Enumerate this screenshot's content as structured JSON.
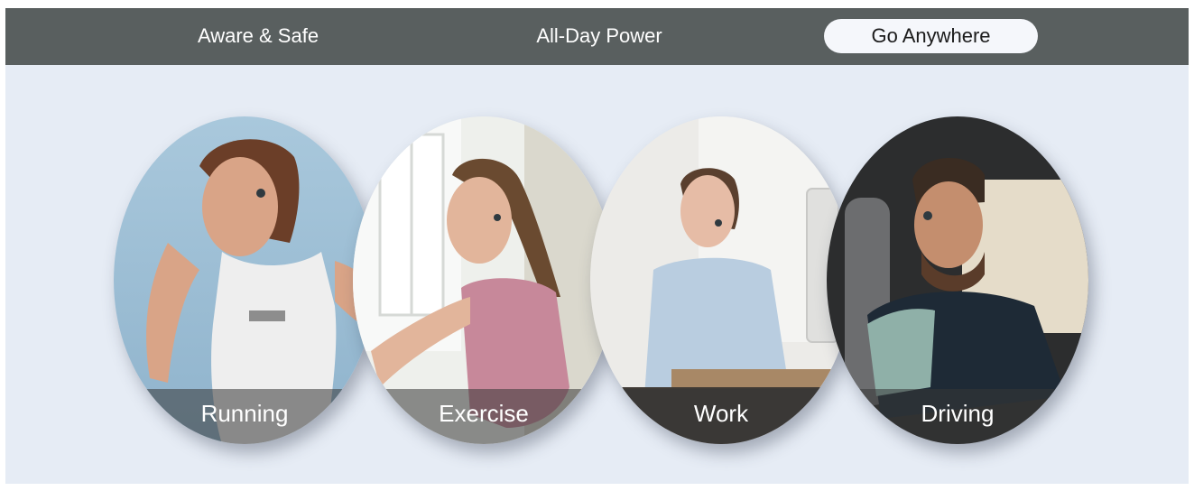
{
  "tabs": [
    {
      "label": "Aware & Safe",
      "active": false
    },
    {
      "label": "All-Day Power",
      "active": false
    },
    {
      "label": "Go Anywhere",
      "active": true
    }
  ],
  "cards": [
    {
      "label": "Running",
      "scene": "runner-in-tank-top-photo"
    },
    {
      "label": "Exercise",
      "scene": "woman-exercising-photo"
    },
    {
      "label": "Work",
      "scene": "woman-working-at-computer-photo"
    },
    {
      "label": "Driving",
      "scene": "man-driving-car-photo"
    }
  ],
  "colors": {
    "tab_bar": "#595f5f",
    "page_background": "#e6ecf5",
    "active_tab": "#f5f7fb",
    "caption_overlay": "rgba(55,55,55,0.55)"
  }
}
